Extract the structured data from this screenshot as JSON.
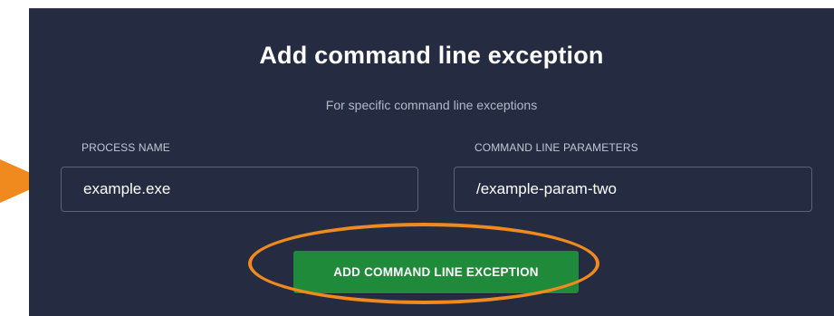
{
  "dialog": {
    "title": "Add command line exception",
    "subtitle": "For specific command line exceptions"
  },
  "fields": {
    "process_name": {
      "label": "PROCESS NAME",
      "value": "example.exe"
    },
    "command_line_parameters": {
      "label": "COMMAND LINE PARAMETERS",
      "value": "/example-param-two"
    }
  },
  "actions": {
    "add_label": "ADD COMMAND LINE EXCEPTION"
  },
  "annotations": {
    "arrow_icon": "arrow-right-icon",
    "highlight_shape": "ellipse",
    "highlight_color": "#f08a1e"
  },
  "colors": {
    "panel_background": "#252b40",
    "button_green": "#1f8a3a",
    "annotation_orange": "#f08a1e"
  }
}
